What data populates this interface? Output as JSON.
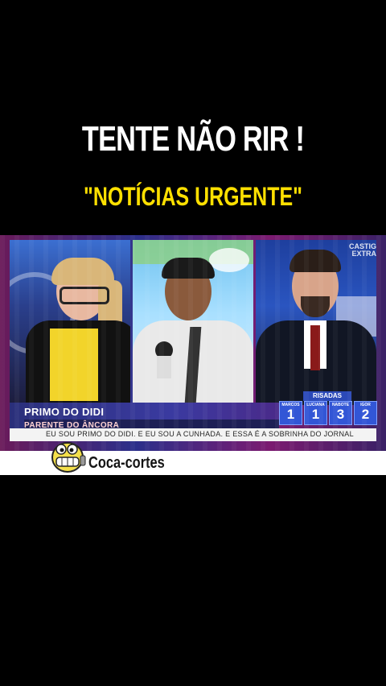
{
  "headline": "TENTE NÃO RIR !",
  "subheadline": "\"NOTÍCIAS URGENTE\"",
  "broadcast": {
    "corner_logo_line1": "CASTIG",
    "corner_logo_line2": "EXTRA",
    "lower_third": {
      "name": "PRIMO DO DIDI",
      "role": "PARENTE DO ÂNCORA"
    },
    "scoreboard": {
      "title": "RISADAS",
      "players": [
        {
          "name": "MARCOS",
          "score": "1"
        },
        {
          "name": "LUCIANA",
          "score": "1"
        },
        {
          "name": "NABOTE",
          "score": "3"
        },
        {
          "name": "IGOR",
          "score": "2"
        }
      ]
    },
    "ticker": "EU SOU PRIMO DO DIDI.   E EU SOU A CUNHADA. E ESSA É A SOBRINHA DO JORNAL"
  },
  "brand": {
    "name": "Coca-cortes",
    "icon": "smiley-mascot-icon"
  },
  "colors": {
    "headline": "#ffffff",
    "subheadline": "#ffe000",
    "lower_third": "#3a3aa0",
    "score_box": "#3256d6"
  }
}
